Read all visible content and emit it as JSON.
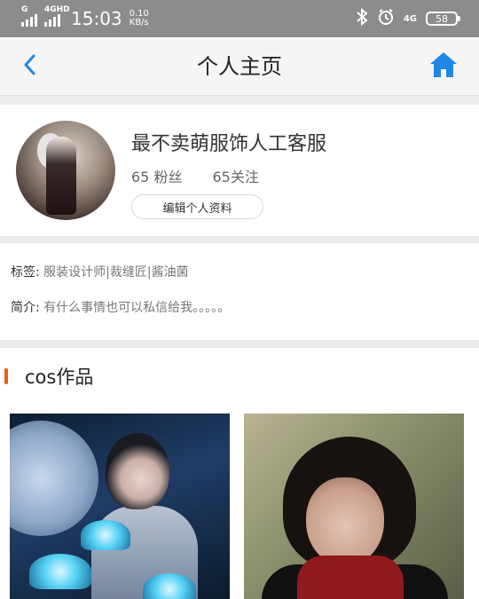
{
  "status_bar": {
    "network_left": "G",
    "network_right": "4GHD",
    "time": "15:03",
    "speed_value": "0.10",
    "speed_unit": "KB/s",
    "signal_4g": "4G",
    "battery": "58",
    "icons": [
      "signal-icon",
      "bluetooth-icon",
      "alarm-icon",
      "battery-icon"
    ]
  },
  "nav": {
    "title": "个人主页",
    "back_icon": "chevron-left-icon",
    "home_icon": "home-icon",
    "accent_color": "#1e88e5"
  },
  "profile": {
    "username": "最不卖萌服饰人工客服",
    "followers": "65 粉丝",
    "following": "65关注",
    "edit_button": "编辑个人资料"
  },
  "info": {
    "tags_label": "标签:",
    "tags_value": "服装设计师|裁缝匠|酱油菌",
    "intro_label": "简介:",
    "intro_value": "有什么事情也可以私信给我。。。。。"
  },
  "cos": {
    "section_title": "cos作品",
    "marker_color": "#f05a12"
  }
}
